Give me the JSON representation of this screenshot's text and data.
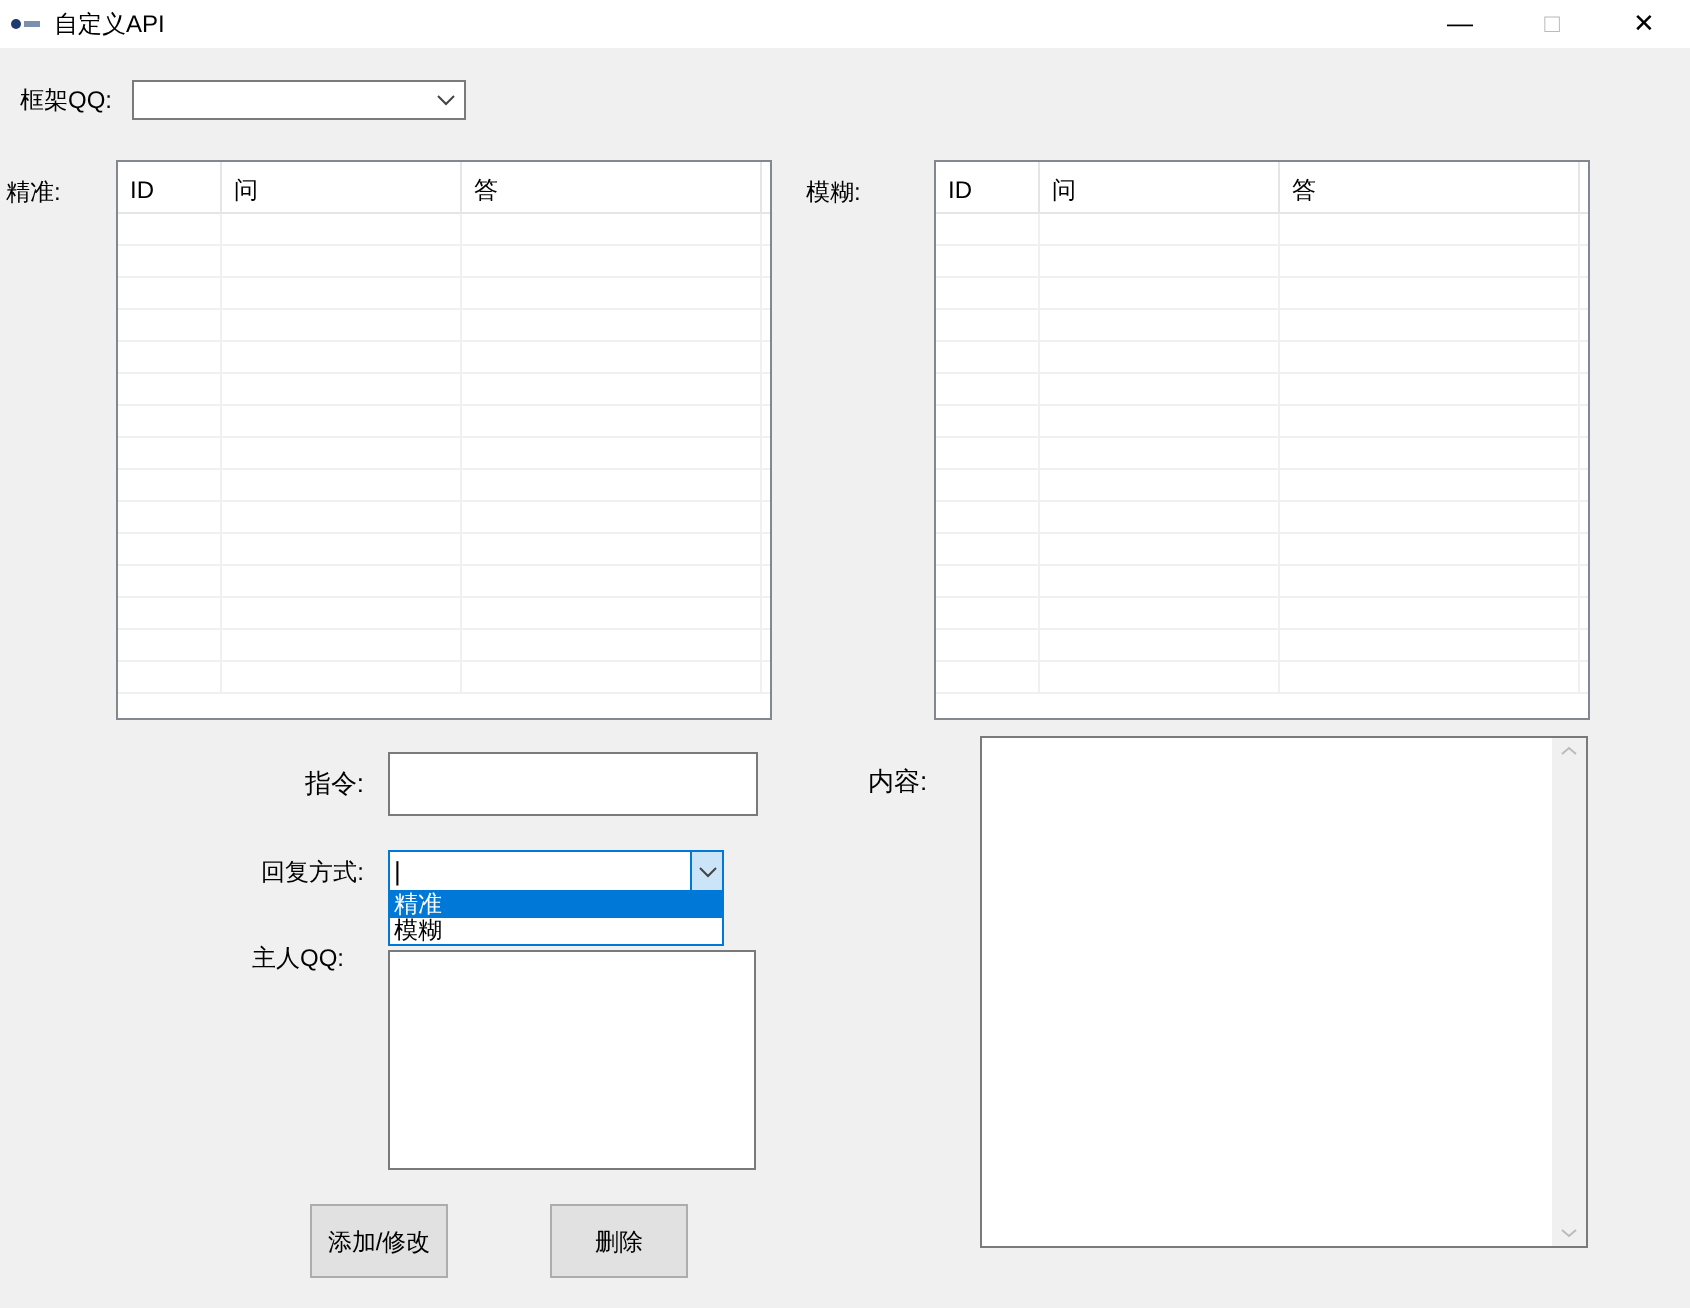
{
  "window": {
    "title": "自定义API",
    "controls": [
      "—",
      "□",
      "✕"
    ]
  },
  "frame_qq": {
    "label": "框架QQ:"
  },
  "tables": [
    {
      "label": "精准:",
      "columns": [
        "ID",
        "问",
        "答"
      ]
    },
    {
      "label": "模糊:",
      "columns": [
        "ID",
        "问",
        "答"
      ]
    }
  ],
  "command": {
    "label": "指令:"
  },
  "reply_mode": {
    "label": "回复方式:",
    "value": "|",
    "expanded": true,
    "options": [
      {
        "label": "精准",
        "selected": true
      },
      {
        "label": "模糊",
        "selected": false
      }
    ]
  },
  "owner_qq": {
    "label": "主人QQ:"
  },
  "content": {
    "label": "内容:"
  },
  "buttons": [
    "添加/修改",
    "删除"
  ]
}
